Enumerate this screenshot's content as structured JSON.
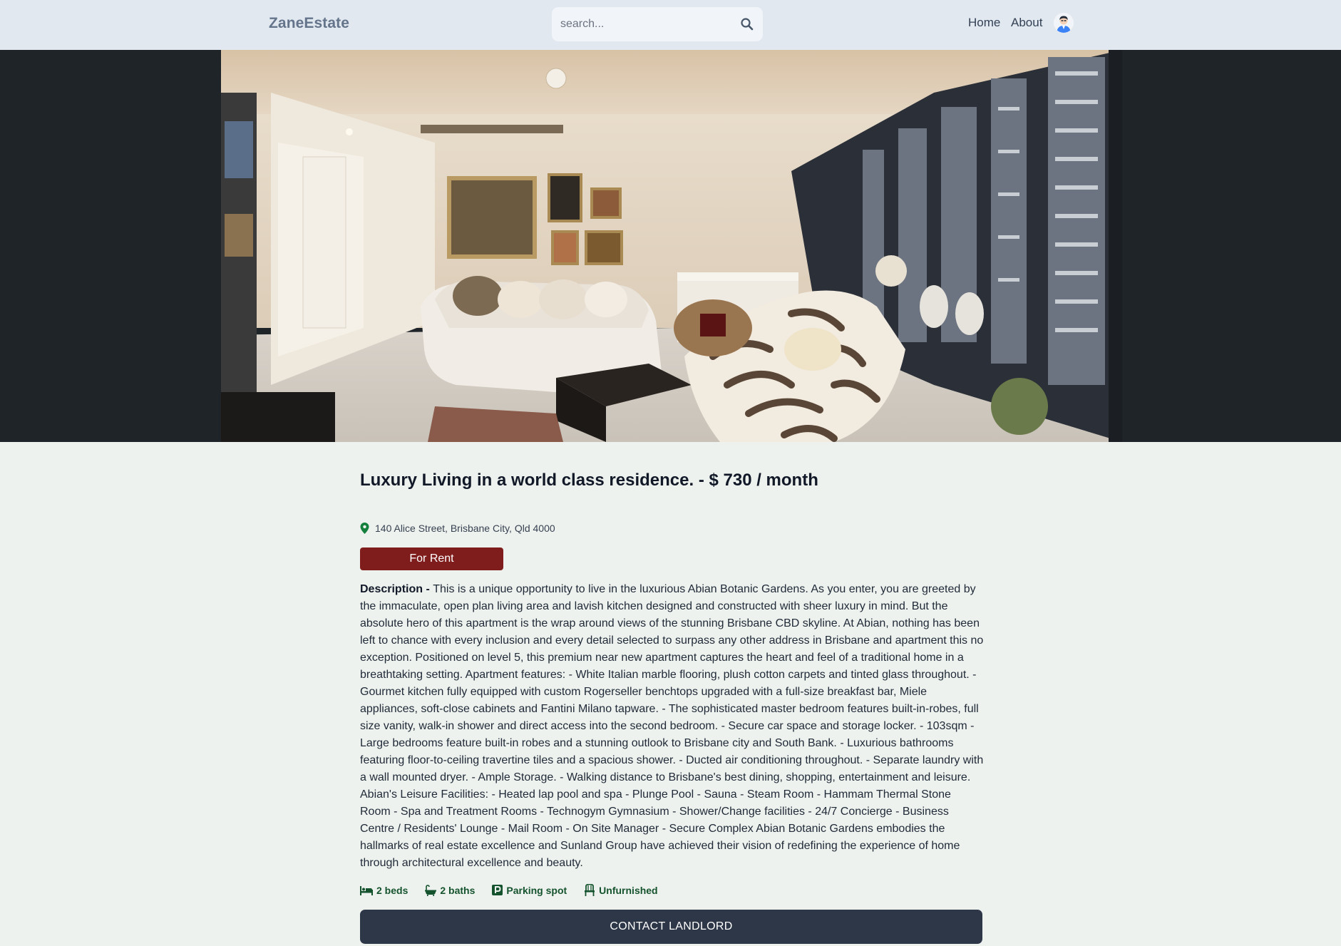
{
  "header": {
    "logo": "ZaneEstate",
    "search_placeholder": "search...",
    "nav": {
      "home": "Home",
      "about": "About"
    }
  },
  "listing": {
    "title": "Luxury Living in a world class residence. - $ 730 / month",
    "address": "140 Alice Street, Brisbane City, Qld 4000",
    "type_badge": "For Rent",
    "description_label": "Description - ",
    "description": "This is a unique opportunity to live in the luxurious Abian Botanic Gardens. As you enter, you are greeted by the immaculate, open plan living area and lavish kitchen designed and constructed with sheer luxury in mind. But the absolute hero of this apartment is the wrap around views of the stunning Brisbane CBD skyline. At Abian, nothing has been left to chance with every inclusion and every detail selected to surpass any other address in Brisbane and apartment this no exception. Positioned on level 5, this premium near new apartment captures the heart and feel of a traditional home in a breathtaking setting. Apartment features: - White Italian marble flooring, plush cotton carpets and tinted glass throughout. - Gourmet kitchen fully equipped with custom Rogerseller benchtops upgraded with a full-size breakfast bar, Miele appliances, soft-close cabinets and Fantini Milano tapware. - The sophisticated master bedroom features built-in-robes, full size vanity, walk-in shower and direct access into the second bedroom. - Secure car space and storage locker. - 103sqm - Large bedrooms feature built-in robes and a stunning outlook to Brisbane city and South Bank. - Luxurious bathrooms featuring floor-to-ceiling travertine tiles and a spacious shower. - Ducted air conditioning throughout. - Separate laundry with a wall mounted dryer. - Ample Storage. - Walking distance to Brisbane's best dining, shopping, entertainment and leisure. Abian's Leisure Facilities: - Heated lap pool and spa - Plunge Pool - Sauna - Steam Room - Hammam Thermal Stone Room - Spa and Treatment Rooms - Technogym Gymnasium - Shower/Change facilities - 24/7 Concierge - Business Centre / Residents' Lounge - Mail Room - On Site Manager - Secure Complex Abian Botanic Gardens embodies the hallmarks of real estate excellence and Sunland Group have achieved their vision of redefining the experience of home through architectural excellence and beauty.",
    "features": {
      "beds": "2 beds",
      "baths": "2 baths",
      "parking": "Parking spot",
      "furnished": "Unfurnished"
    },
    "contact_label": "CONTACT LANDLORD"
  },
  "colors": {
    "header_bg": "#e2e8f0",
    "page_bg": "#eef2ee",
    "badge_bg": "#7f1d1d",
    "feature_text": "#14532d",
    "button_bg": "#2d3748"
  },
  "icons": {
    "search": "search-icon",
    "location": "map-pin-icon",
    "beds": "bed-icon",
    "baths": "bath-icon",
    "parking": "parking-icon",
    "furnished": "chair-icon"
  }
}
